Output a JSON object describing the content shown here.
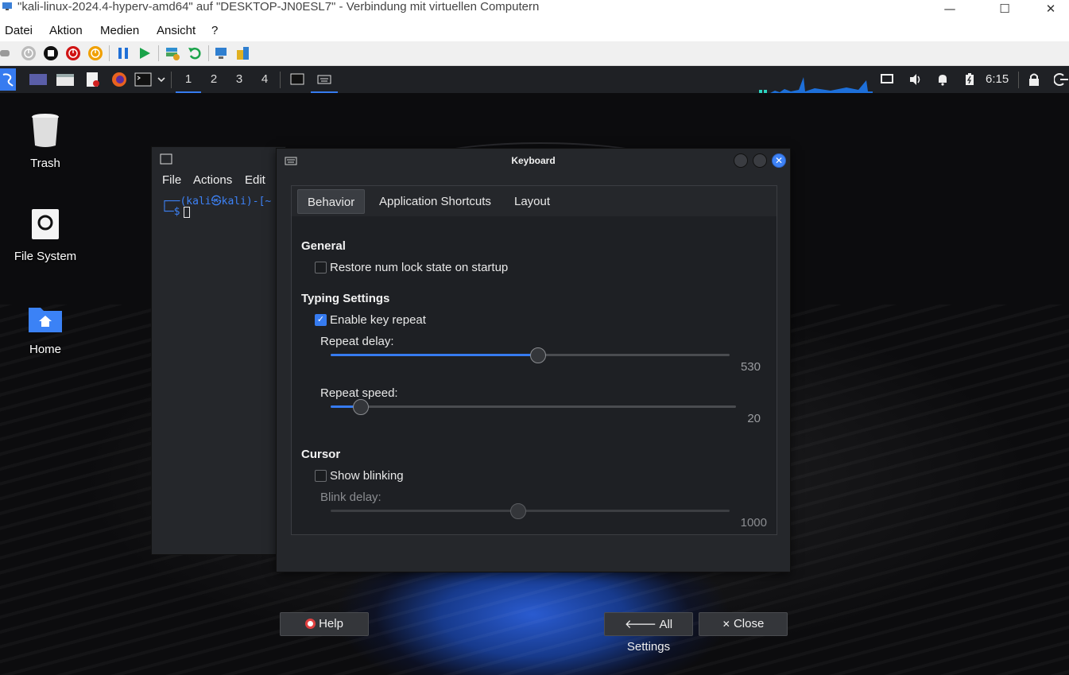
{
  "host": {
    "title": "\"kali-linux-2024.4-hyperv-amd64\" auf \"DESKTOP-JN0ESL7\" - Verbindung mit virtuellen Computern",
    "menu": [
      "Datei",
      "Aktion",
      "Medien",
      "Ansicht",
      "?"
    ],
    "window_buttons": {
      "minimize": "—",
      "maximize": "☐",
      "close": "✕"
    }
  },
  "panel": {
    "workspaces": [
      "1",
      "2",
      "3",
      "4"
    ],
    "clock": "6:15"
  },
  "desktop": {
    "icons": [
      {
        "label": "Trash",
        "icon": "trash-icon"
      },
      {
        "label": "File System",
        "icon": "drive-icon"
      },
      {
        "label": "Home",
        "icon": "home-folder-icon"
      }
    ]
  },
  "terminal": {
    "menu": [
      "File",
      "Actions",
      "Edit"
    ],
    "prompt_line1": "┌──(kali㉿kali)-[~",
    "prompt_line2": "└─$ "
  },
  "dialog": {
    "title": "Keyboard",
    "tabs": [
      "Behavior",
      "Application Shortcuts",
      "Layout"
    ],
    "active_tab": "Behavior",
    "general": {
      "heading": "General",
      "restore_numlock": {
        "label": "Restore num lock state on startup",
        "checked": false
      }
    },
    "typing": {
      "heading": "Typing Settings",
      "enable_repeat": {
        "label": "Enable key repeat",
        "checked": true
      },
      "repeat_delay": {
        "label": "Repeat delay:",
        "value": "530",
        "fraction": 0.52
      },
      "repeat_speed": {
        "label": "Repeat speed:",
        "value": "20",
        "fraction": 0.075
      }
    },
    "cursor": {
      "heading": "Cursor",
      "show_blinking": {
        "label": "Show blinking",
        "checked": false
      },
      "blink_delay": {
        "label": "Blink delay:",
        "value": "1000",
        "fraction": 0.47
      }
    },
    "buttons": {
      "help": "Help",
      "all_settings": "All Settings",
      "close": "Close"
    }
  },
  "colors": {
    "accent": "#367bf0",
    "panel": "#1f2125",
    "dialog": "#25272b"
  }
}
